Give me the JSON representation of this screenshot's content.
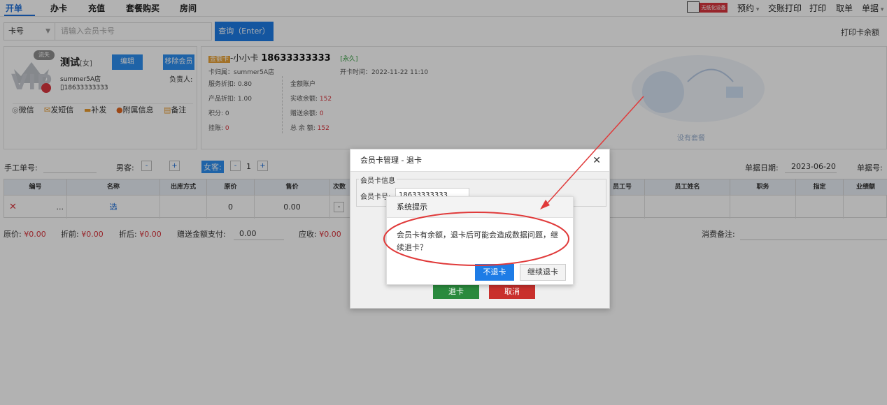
{
  "top_tabs": [
    "开单",
    "办卡",
    "充值",
    "套餐购买",
    "房间"
  ],
  "device_badge": "无纸化设备",
  "right_nav": {
    "reserve": "预约",
    "shift_print": "交账打印",
    "print": "打印",
    "pickup": "取单",
    "orders": "单据"
  },
  "search": {
    "type_label": "卡号",
    "placeholder": "请输入会员卡号",
    "query_btn": "查询（Enter）",
    "print_balance": "打印卡余额"
  },
  "member": {
    "lost_badge": "流失",
    "vip": "VIP",
    "name": "测试",
    "gender": "[女]",
    "edit_btn": "编辑",
    "remove_btn": "移除会员",
    "store": "summer5A店",
    "manager_label": "负责人:",
    "phone": "18633333333",
    "links": [
      "微信",
      "发短信",
      "补发",
      "附属信息",
      "备注"
    ]
  },
  "card": {
    "type_badge": "金额卡",
    "name": "-小小卡",
    "number": "18633333333",
    "validity": "[永久]",
    "belong": "卡归属：summer5A店",
    "open_time": "开卡时间：2022-11-22 11:10",
    "service_discount": "服务折扣: 0.80",
    "product_discount": "产品折扣: 1.00",
    "points_label": "积分:",
    "points": "0",
    "credit_label": "挂账:",
    "credit": "0",
    "account_label": "金额账户",
    "paid_label": "实收余额:",
    "paid": "152",
    "gift_label": "赠送余额:",
    "gift": "0",
    "total_label": "总 余 额:",
    "total": "152",
    "no_package": "没有套餐"
  },
  "form": {
    "manual_no": "手工单号:",
    "male": "男客:",
    "female": "女客:",
    "female_count": "1",
    "date_label": "单据日期:",
    "date": "2023-06-20",
    "order_no": "单据号:"
  },
  "table": {
    "headers": [
      "编号",
      "名称",
      "出库方式",
      "原价",
      "售价",
      "次数",
      "员工号",
      "员工姓名",
      "职务",
      "指定",
      "业绩额"
    ],
    "row": {
      "delete": "✕",
      "more": "...",
      "select": "选",
      "original": "0",
      "price": "0.00",
      "minus": "-"
    }
  },
  "summary": {
    "orig_label": "原价:",
    "orig": "¥0.00",
    "before_label": "折前:",
    "before": "¥0.00",
    "after_label": "折后:",
    "after": "¥0.00",
    "gift_pay_label": "赠送金额支付:",
    "gift_pay": "0.00",
    "receivable_label": "应收:",
    "receivable": "¥0.00",
    "note_label": "消费备注:"
  },
  "dialog": {
    "title": "会员卡管理 - 退卡",
    "section": "会员卡信息",
    "card_label": "会员卡号:",
    "card_value": "18633333333",
    "return_btn": "退卡",
    "cancel_btn": "取消"
  },
  "prompt": {
    "title": "系统提示",
    "message": "会员卡有余额，退卡后可能会造成数据问题，继续退卡？",
    "no_btn": "不退卡",
    "continue_btn": "继续退卡"
  }
}
